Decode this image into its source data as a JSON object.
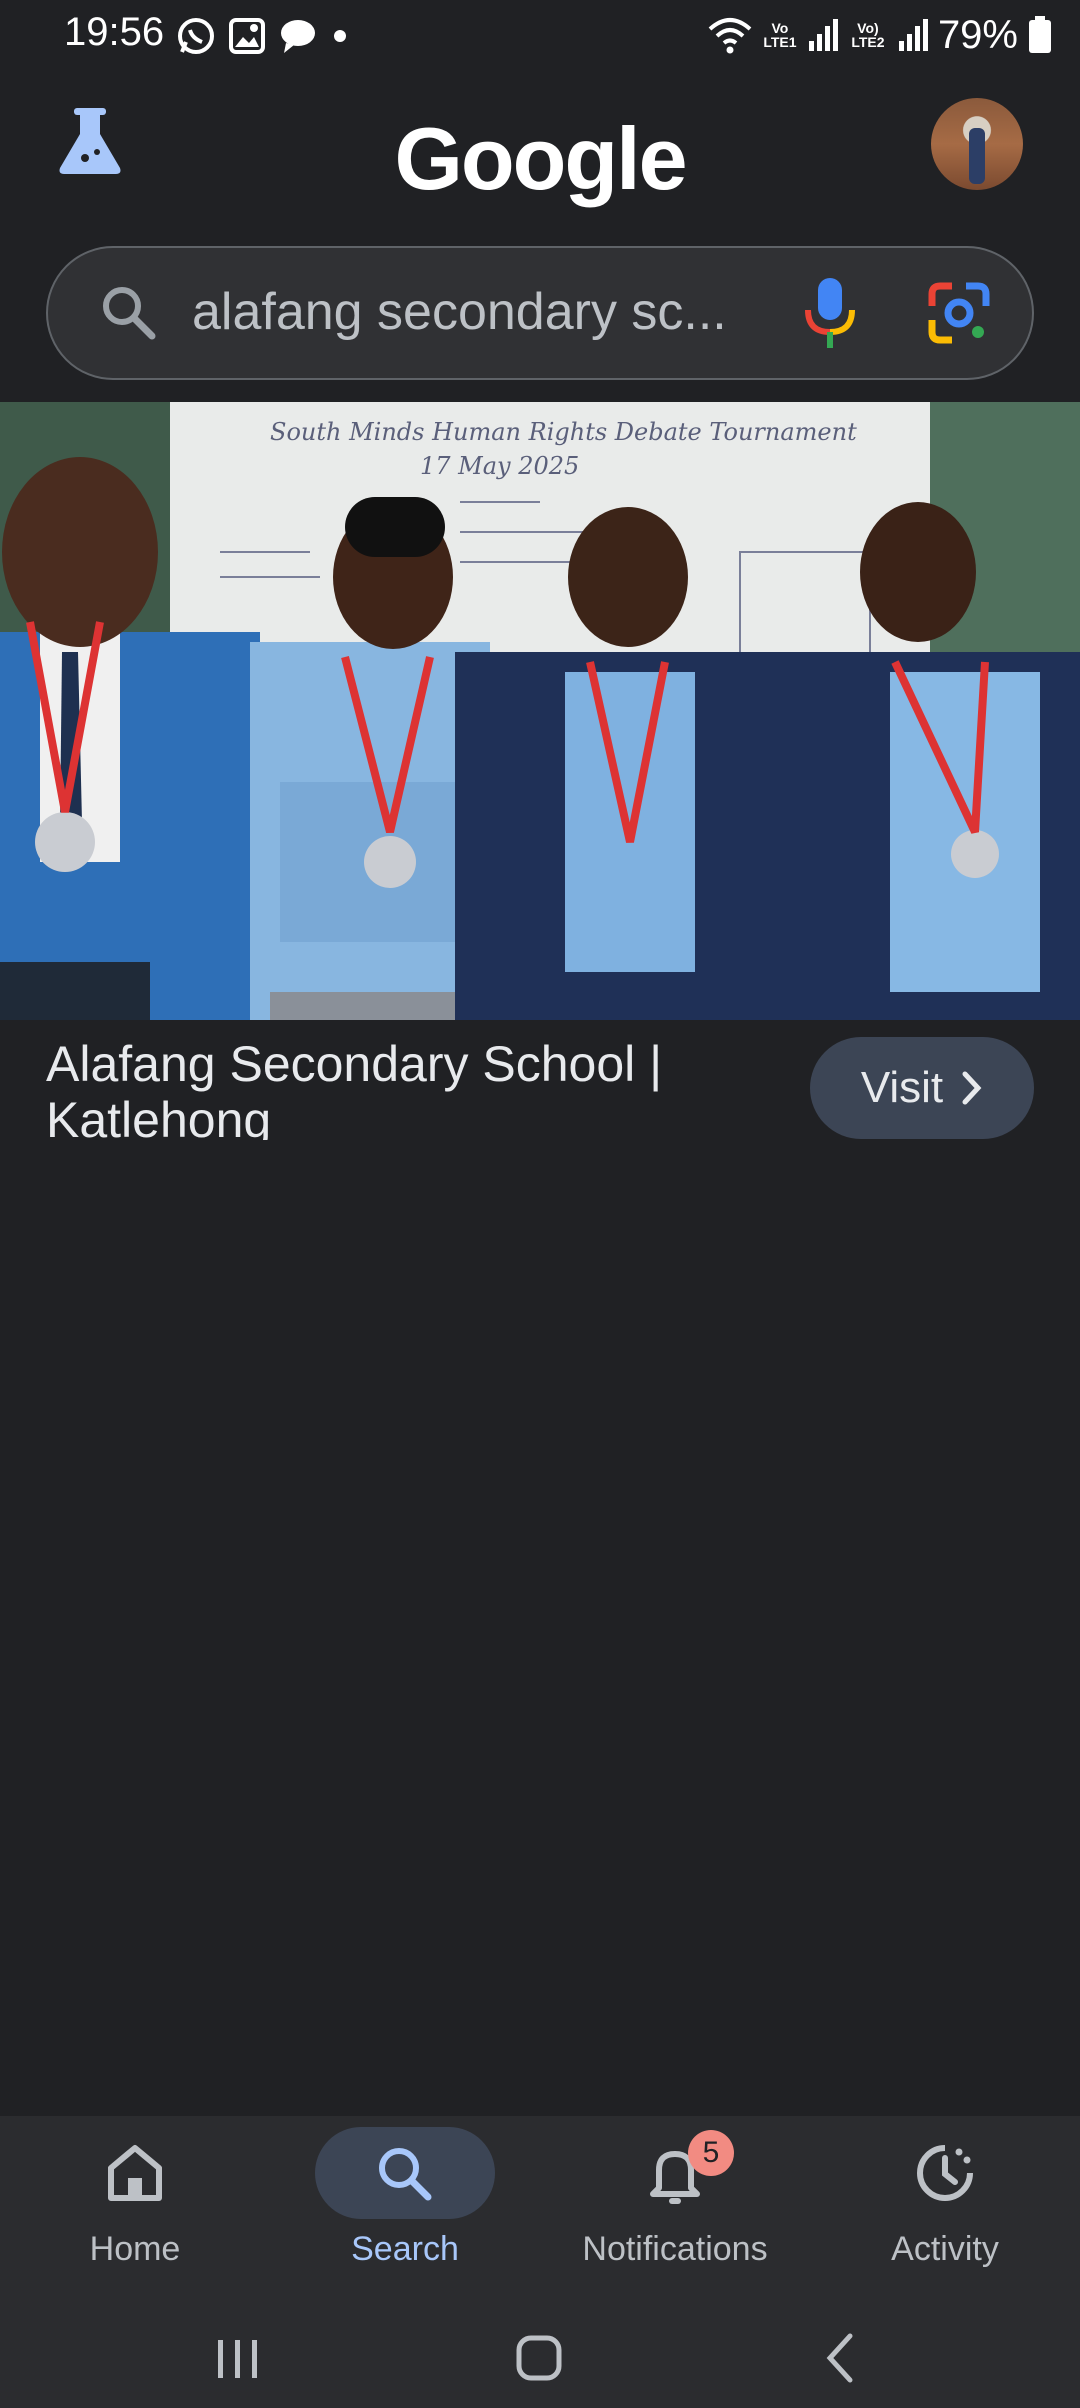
{
  "status_bar": {
    "time": "19:56",
    "battery": "79%",
    "net1": "Vo LTE1",
    "net2": "Vo) LTE2"
  },
  "header": {
    "logo": "Google"
  },
  "search": {
    "query": "alafang secondary sc..."
  },
  "result": {
    "image_text_board_title": "South Minds Human Rights Debate Tournament",
    "image_text_board_date": "17 May 2025",
    "title": "Alafang Secondary School | Katlehong",
    "visit_label": "Visit"
  },
  "bottom_nav": {
    "items": [
      {
        "label": "Home",
        "icon": "home-icon"
      },
      {
        "label": "Search",
        "icon": "search-icon"
      },
      {
        "label": "Notifications",
        "icon": "bell-icon",
        "badge": "5"
      },
      {
        "label": "Activity",
        "icon": "activity-icon"
      }
    ],
    "active_index": 1
  },
  "colors": {
    "background": "#202124",
    "accent": "#a8c7fa",
    "pill": "#3c4555"
  }
}
